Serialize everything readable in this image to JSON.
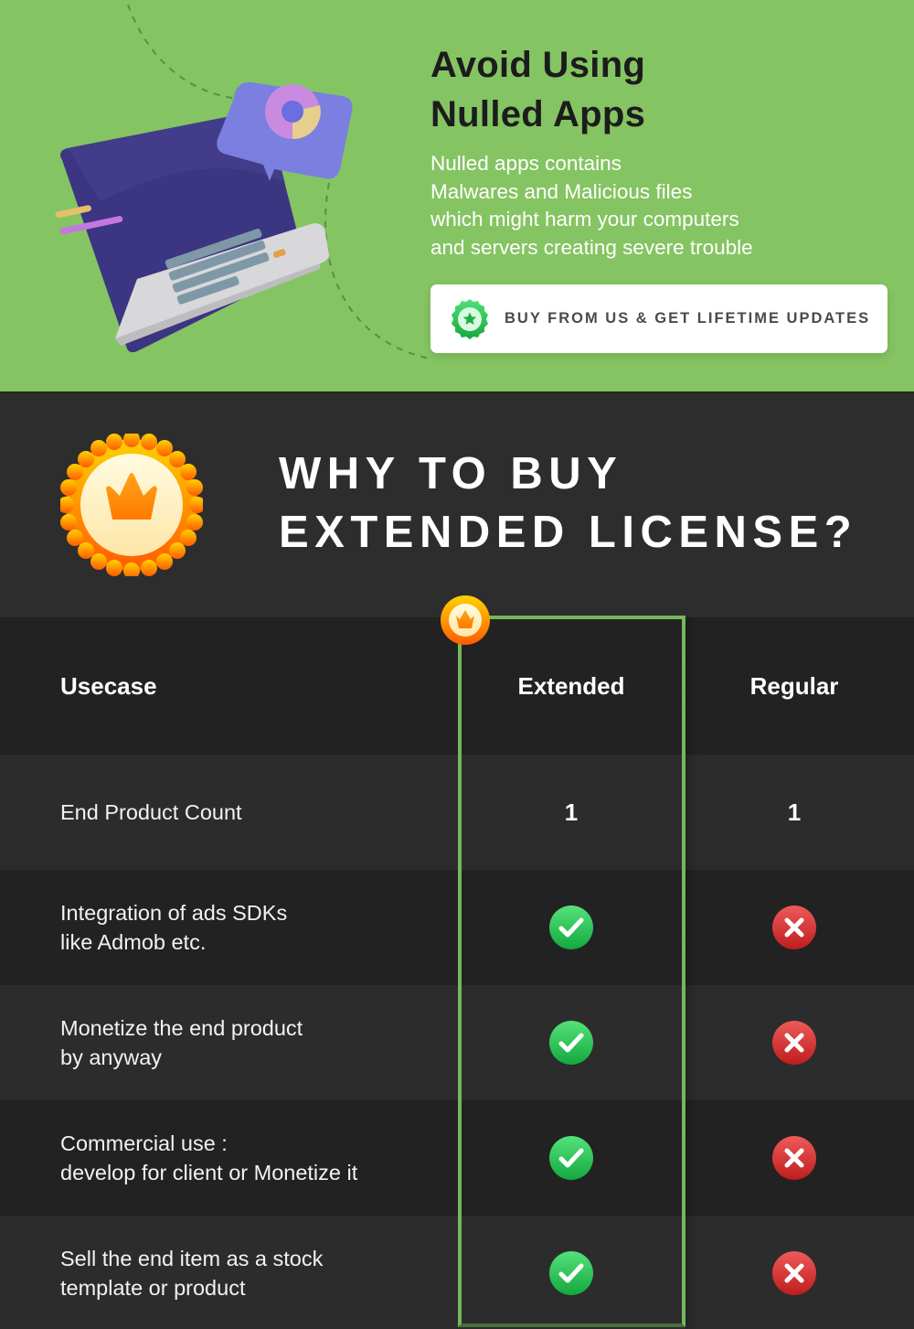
{
  "banner": {
    "title_lines": [
      "Avoid Using",
      "Nulled Apps"
    ],
    "description_lines": [
      "Nulled apps contains",
      "Malwares and Malicious files",
      "which might harm your computers",
      "and servers creating severe trouble"
    ],
    "cta_label": "BUY FROM US & GET LIFETIME UPDATES",
    "cta_icon": "star-badge-icon",
    "illustration": "laptop-with-chart-bubble-illustration",
    "background_color": "#85c462"
  },
  "section": {
    "icon": "crown-badge-icon",
    "title_lines": [
      "WHY TO BUY",
      "EXTENDED LICENSE?"
    ]
  },
  "table": {
    "columns": [
      "Usecase",
      "Extended",
      "Regular"
    ],
    "highlight_column": "Extended",
    "highlight_color": "#74b85b",
    "rows": [
      {
        "usecase": [
          "End Product Count"
        ],
        "extended": "1",
        "regular": "1"
      },
      {
        "usecase": [
          "Integration of ads SDKs",
          "like Admob etc."
        ],
        "extended": "check",
        "regular": "cross"
      },
      {
        "usecase": [
          "Monetize the end product",
          "by anyway"
        ],
        "extended": "check",
        "regular": "cross"
      },
      {
        "usecase": [
          "Commercial use :",
          "develop for client or Monetize it"
        ],
        "extended": "check",
        "regular": "cross"
      },
      {
        "usecase": [
          "Sell the end item as a stock",
          "template or product"
        ],
        "extended": "check",
        "regular": "cross"
      }
    ]
  },
  "colors": {
    "check": "#22b24c",
    "cross": "#d93535",
    "badge_orange": "#ff8a00"
  }
}
